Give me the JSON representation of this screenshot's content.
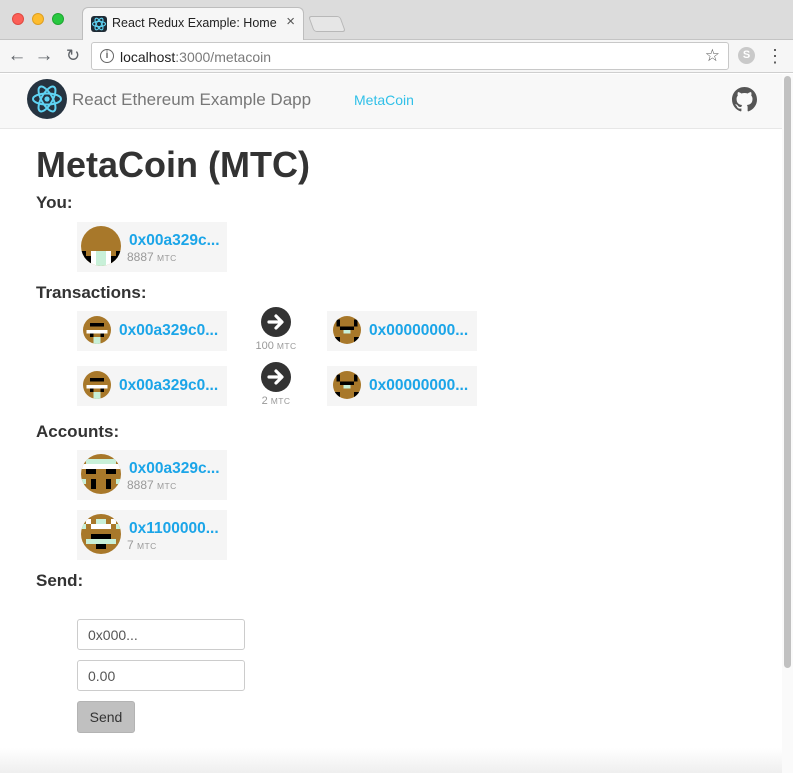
{
  "browser": {
    "tab_title": "React Redux Example: Home",
    "tab_close": "×",
    "url_host": "localhost",
    "url_path": ":3000/metacoin",
    "icons": {
      "back": "back-arrow-icon",
      "forward": "forward-arrow-icon",
      "reload": "reload-icon",
      "info": "info-icon",
      "bookmark": "star-icon",
      "extension": "skype-extension-icon",
      "menu": "kebab-menu-icon"
    }
  },
  "navbar": {
    "brand": "React Ethereum Example Dapp",
    "link": "MetaCoin",
    "icons": {
      "logo": "react-logo-icon",
      "github": "github-icon"
    }
  },
  "main": {
    "title": "MetaCoin (MTC)",
    "sections": {
      "you": "You:",
      "transactions": "Transactions:",
      "accounts": "Accounts:",
      "send": "Send:"
    },
    "you": {
      "address": "0x00a329c...",
      "balance": "8887",
      "unit": "MTC"
    },
    "transactions": [
      {
        "from": "0x00a329c0...",
        "to": "0x00000000...",
        "amount": "100",
        "unit": "MTC"
      },
      {
        "from": "0x00a329c0...",
        "to": "0x00000000...",
        "amount": "2",
        "unit": "MTC"
      }
    ],
    "accounts": [
      {
        "address": "0x00a329c...",
        "balance": "8887",
        "unit": "MTC"
      },
      {
        "address": "0x1100000...",
        "balance": "7",
        "unit": "MTC"
      }
    ],
    "send": {
      "address_placeholder": "0x000...",
      "amount_placeholder": "0.00",
      "button": "Send"
    }
  },
  "colors": {
    "link": "#1ba5e8",
    "nav_link": "#31c0e8",
    "identicon_brown": "#a8782a",
    "identicon_mint": "#c8f0d8"
  }
}
